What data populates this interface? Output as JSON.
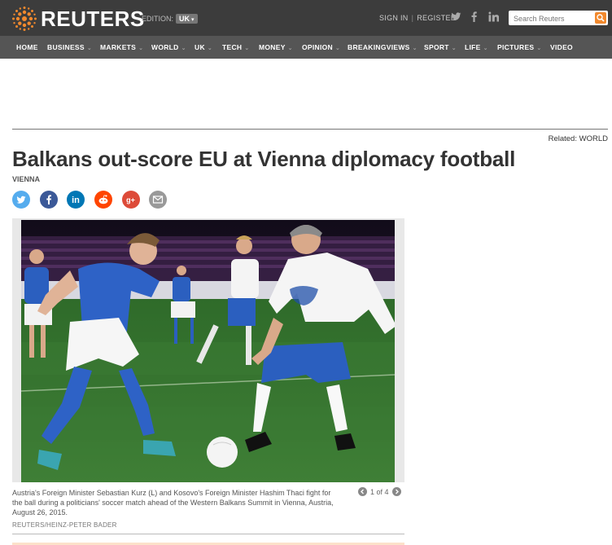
{
  "header": {
    "brand": "REUTERS",
    "edition_label": "EDITION:",
    "edition_value": "UK",
    "sign_in": "SIGN IN",
    "register": "REGISTER",
    "search_placeholder": "Search Reuters",
    "social": [
      "twitter-icon",
      "facebook-icon",
      "linkedin-icon"
    ],
    "accent_color": "#f2892d",
    "bar_color": "#3c3c3c"
  },
  "nav": {
    "items": [
      {
        "label": "HOME",
        "dropdown": false
      },
      {
        "label": "BUSINESS",
        "dropdown": true
      },
      {
        "label": "MARKETS",
        "dropdown": true
      },
      {
        "label": "WORLD",
        "dropdown": true
      },
      {
        "label": "UK",
        "dropdown": true
      },
      {
        "label": "TECH",
        "dropdown": true
      },
      {
        "label": "MONEY",
        "dropdown": true
      },
      {
        "label": "OPINION",
        "dropdown": true
      },
      {
        "label": "BREAKINGVIEWS",
        "dropdown": true
      },
      {
        "label": "SPORT",
        "dropdown": true
      },
      {
        "label": "LIFE",
        "dropdown": true
      },
      {
        "label": "PICTURES",
        "dropdown": true
      },
      {
        "label": "VIDEO",
        "dropdown": false
      }
    ]
  },
  "article": {
    "related_label": "Related:",
    "related_value": "WORLD",
    "headline": "Balkans out-score EU at Vienna diplomacy football",
    "dateline": "VIENNA",
    "share": [
      {
        "icon": "twitter-icon",
        "color": "#55acee"
      },
      {
        "icon": "facebook-icon",
        "color": "#3b5998"
      },
      {
        "icon": "linkedin-icon",
        "color": "#0077b5"
      },
      {
        "icon": "reddit-icon",
        "color": "#ff4500"
      },
      {
        "icon": "google-plus-icon",
        "color": "#dd4b39"
      },
      {
        "icon": "email-icon",
        "color": "#999999"
      }
    ],
    "photo": {
      "alt": "Two men in football kit compete for the ball on a pitch at night",
      "caption": "Austria's Foreign Minister Sebastian Kurz (L) and Kosovo's Foreign Minister Hashim Thaci fight for the ball during a politicians' soccer match ahead of the Western Balkans Summit in Vienna, Austria, August 26, 2015.",
      "credit": "REUTERS/HEINZ-PETER BADER",
      "pager_text": "1 of 4"
    }
  }
}
